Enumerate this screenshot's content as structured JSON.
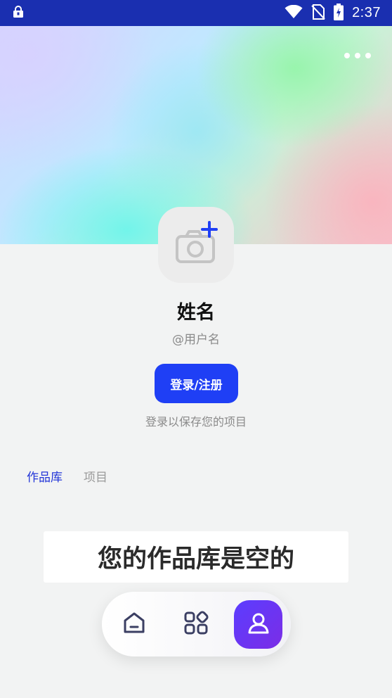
{
  "status_bar": {
    "time": "2:37",
    "icons": [
      "lock-icon",
      "wifi-icon",
      "no-sim-icon",
      "battery-charging-icon"
    ]
  },
  "hero": {
    "more_icon": "more-horizontal-icon"
  },
  "profile": {
    "avatar_icon": "camera-plus-icon",
    "name": "姓名",
    "username": "@用户名",
    "login_button": "登录/注册",
    "login_hint": "登录以保存您的项目"
  },
  "tabs": [
    {
      "label": "作品库",
      "active": true
    },
    {
      "label": "项目",
      "active": false
    }
  ],
  "empty_state": {
    "text": "您的作品库是空的"
  },
  "bottom_nav": {
    "items": [
      {
        "icon": "home-icon",
        "active": false
      },
      {
        "icon": "apps-icon",
        "active": false
      },
      {
        "icon": "profile-icon",
        "active": true
      }
    ]
  },
  "colors": {
    "status_bar": "#1a2fb0",
    "accent": "#1f3ff5",
    "tab_active": "#2235d8",
    "nav_active": "#5b3dff"
  }
}
